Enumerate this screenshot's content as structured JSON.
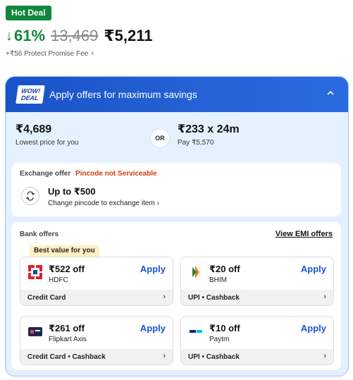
{
  "badge": {
    "hot_deal": "Hot Deal"
  },
  "price": {
    "discount": "61%",
    "mrp": "13,469",
    "final": "₹5,211"
  },
  "fee": {
    "text": "+₹56 Protect Promise Fee"
  },
  "offers": {
    "title": "Apply offers for maximum savings",
    "logo_line1": "WOW!",
    "logo_line2": "DEAL",
    "lowest_price": "₹4,689",
    "lowest_label": "Lowest price for you",
    "or": "OR",
    "emi_price": "₹233 x 24m",
    "emi_label": "Pay ₹5,570"
  },
  "exchange": {
    "label": "Exchange offer",
    "warning": "Pincode not Serviceable",
    "amount": "Up to ₹500",
    "sub": "Change pincode to exchange item"
  },
  "bank": {
    "title": "Bank offers",
    "emi_link": "View EMI offers",
    "best_value": "Best value for you",
    "items": [
      {
        "amount": "₹522 off",
        "bank": "HDFC",
        "apply": "Apply",
        "foot": "Credit Card",
        "icon": "hdfc-logo-icon"
      },
      {
        "amount": "₹20 off",
        "bank": "BHIM",
        "apply": "Apply",
        "foot": "UPI • Cashback",
        "icon": "bhim-logo-icon"
      },
      {
        "amount": "₹261 off",
        "bank": "Flipkart Axis",
        "apply": "Apply",
        "foot": "Credit Card • Cashback",
        "icon": "flipkart-axis-card-icon"
      },
      {
        "amount": "₹10 off",
        "bank": "Paytm",
        "apply": "Apply",
        "foot": "UPI • Cashback",
        "icon": "paytm-logo-icon"
      }
    ]
  },
  "colors": {
    "green": "#11873a",
    "blue": "#1a55d6",
    "header_blue": "#1953c8",
    "warning": "#d63a11"
  }
}
